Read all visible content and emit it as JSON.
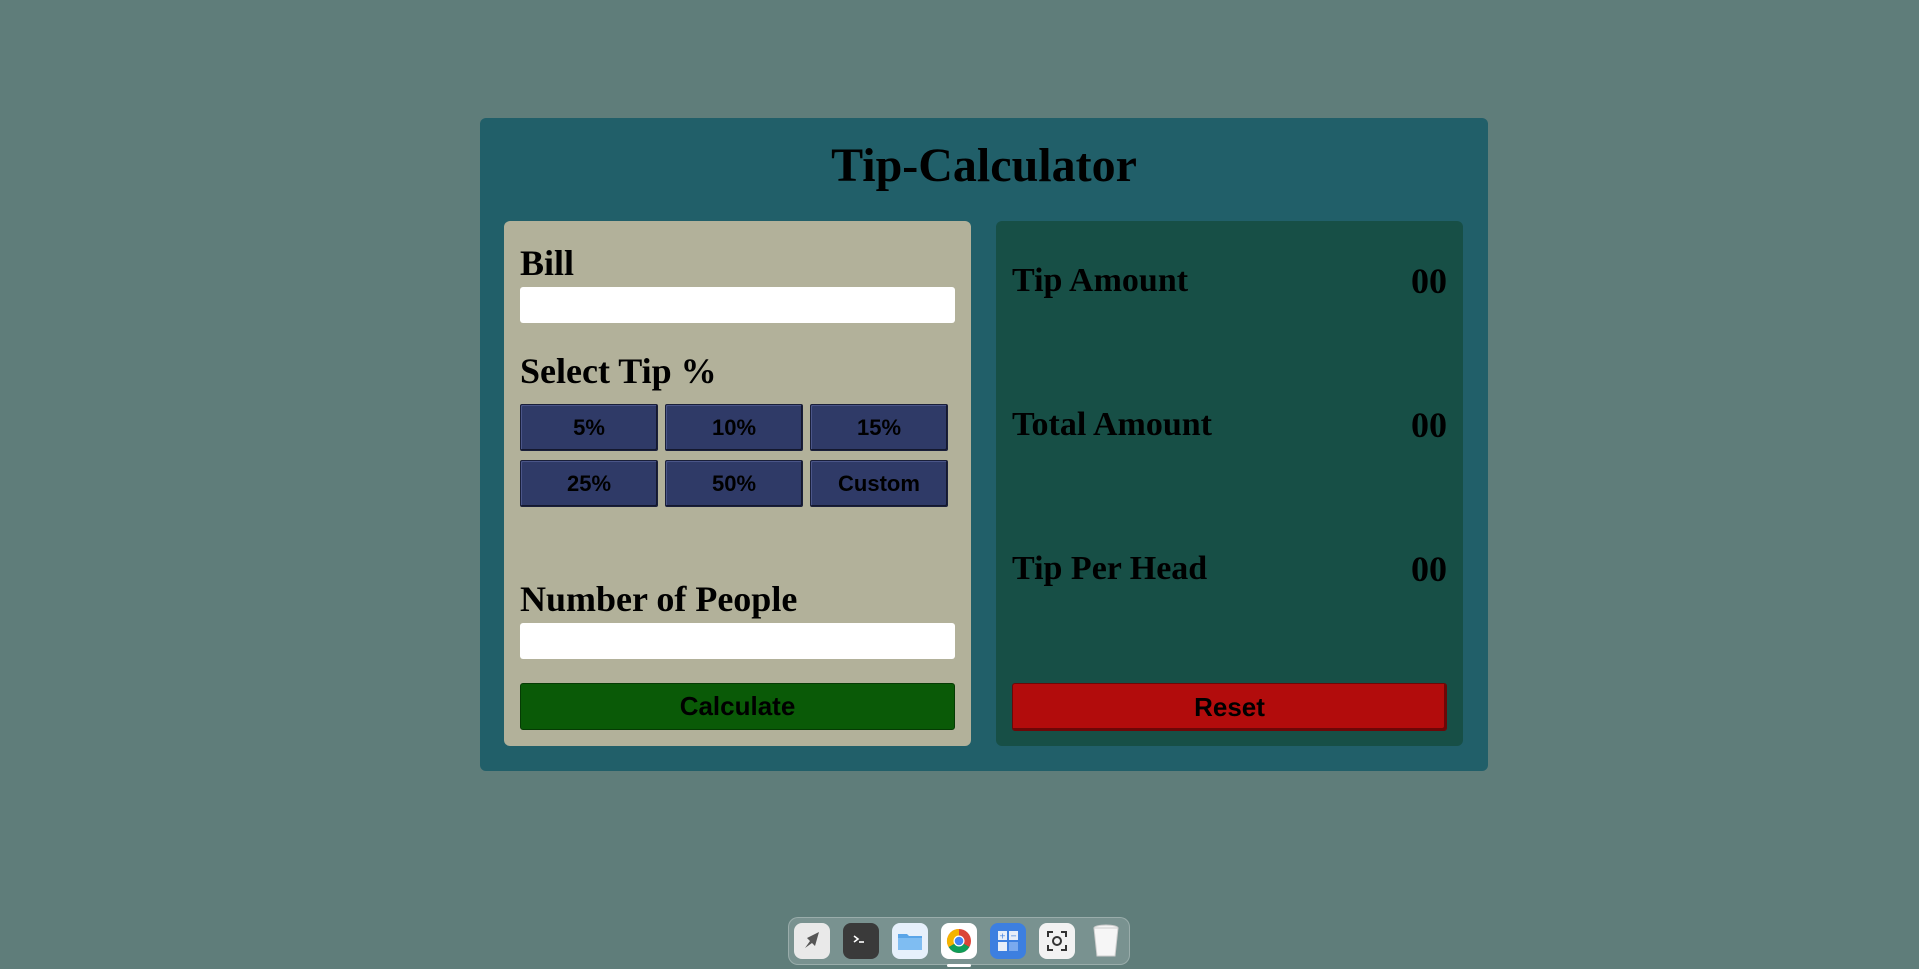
{
  "app": {
    "title": "Tip-Calculator"
  },
  "inputs": {
    "bill_label": "Bill",
    "bill_value": "",
    "tip_label": "Select Tip %",
    "tip_options": [
      "5%",
      "10%",
      "15%",
      "25%",
      "50%",
      "Custom"
    ],
    "people_label": "Number of People",
    "people_value": "",
    "calculate_label": "Calculate"
  },
  "results": {
    "tip_amount_label": "Tip Amount",
    "tip_amount_value": "00",
    "total_amount_label": "Total Amount",
    "total_amount_value": "00",
    "tip_per_head_label": "Tip Per Head",
    "tip_per_head_value": "00",
    "reset_label": "Reset"
  },
  "dock": {
    "items": [
      {
        "icon": "rocket-launcher-icon"
      },
      {
        "icon": "terminal-icon"
      },
      {
        "icon": "folder-icon"
      },
      {
        "icon": "chrome-icon",
        "active": true
      },
      {
        "icon": "calculator-icon"
      },
      {
        "icon": "screenshot-icon"
      },
      {
        "icon": "trash-icon"
      }
    ]
  },
  "colors": {
    "background": "#5f7d7a",
    "app_panel": "#215f69",
    "left_panel": "#b2b19a",
    "right_panel": "#174f46",
    "tip_button": "#2f3a67",
    "calculate_button": "#0a5a07",
    "reset_button": "#b20c0c"
  }
}
